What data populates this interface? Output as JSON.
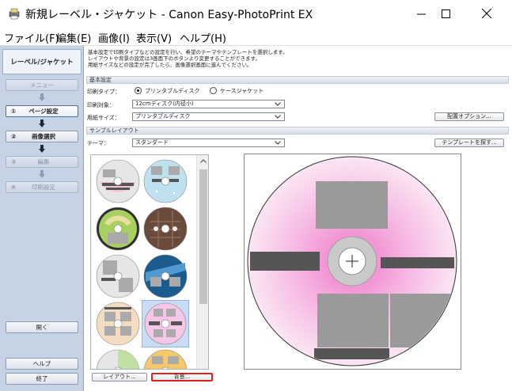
{
  "window": {
    "title": "新規レーベル・ジャケット - Canon Easy-PhotoPrint EX",
    "icon": "printer-app-icon"
  },
  "menu": [
    "ファイル(F)",
    "編集(E)",
    "画像(I)",
    "表示(V)",
    "ヘルプ(H)"
  ],
  "sidebar": {
    "header": "レーベル/ジャケット",
    "menu_button": "メニュー",
    "steps": [
      {
        "num": "①",
        "label": "ページ設定",
        "state": "current"
      },
      {
        "num": "②",
        "label": "画像選択",
        "state": "active"
      },
      {
        "num": "③",
        "label": "編集",
        "state": "disabled"
      },
      {
        "num": "④",
        "label": "印刷設定",
        "state": "disabled"
      }
    ],
    "open_button": "開く",
    "help_button": "ヘルプ",
    "exit_button": "終了"
  },
  "info_text": [
    "基本設定で印刷タイプなどの設定を行い、希望のテーマやテンプレートを選択します。",
    "レイアウトや背景の設定は3画面下のボタンより変更することができます。",
    "用紙サイズなどの設定が完了したら、画像選択画面に進んでください。"
  ],
  "basic": {
    "section_title": "基本設定",
    "print_type_label": "印刷タイプ：",
    "print_type_options": [
      "プリンタブルディスク",
      "ケースジャケット"
    ],
    "print_type_selected": 0,
    "print_target_label": "印刷対象：",
    "print_target_value": "12cmディスク(内径小)",
    "paper_size_label": "用紙サイズ：",
    "paper_size_value": "プリンタブルディスク",
    "layout_options_button": "配置オプション..."
  },
  "sample": {
    "section_title": "サンプルレイアウト",
    "theme_label": "テーマ：",
    "theme_value": "スタンダード",
    "find_template_button": "テンプレートを探す...",
    "layout_button": "レイアウト...",
    "background_button": "背景..."
  },
  "colors": {
    "sidebar_bg": "#c5d3e5",
    "preview_disc_pink": "#f0a8dc",
    "photo_frame": "#9a9a9a",
    "text_frame": "#555555",
    "highlight": "#dd2222"
  }
}
